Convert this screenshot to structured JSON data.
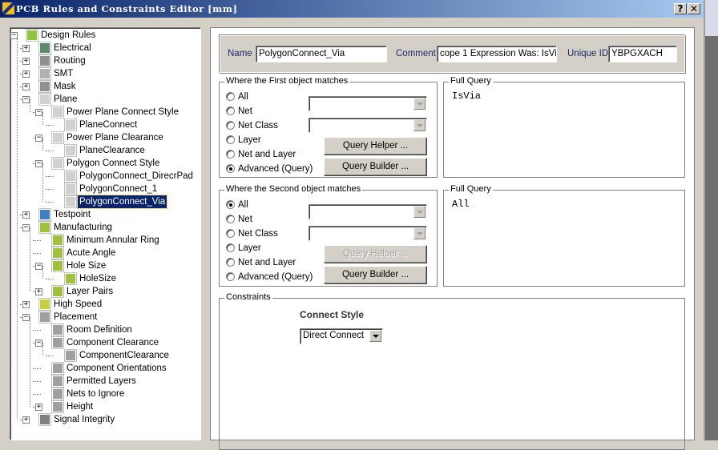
{
  "window": {
    "title": "PCB Rules and Constraints Editor [mm]",
    "help_label": "?",
    "close_label": "✕"
  },
  "colors": {
    "title_start": "#0a246a",
    "title_end": "#a6caf0",
    "selection": "#0a246a",
    "face": "#d4d0c8"
  },
  "tree": [
    {
      "label": "Design Rules",
      "level": 0,
      "exp": "-",
      "icon": "design-rules-folder-icon",
      "color": "#8fc43c"
    },
    {
      "label": "Electrical",
      "level": 1,
      "exp": "+",
      "icon": "electrical-icon",
      "color": "#5a8a6a"
    },
    {
      "label": "Routing",
      "level": 1,
      "exp": "+",
      "icon": "routing-icon",
      "color": "#909090"
    },
    {
      "label": "SMT",
      "level": 1,
      "exp": "+",
      "icon": "smt-icon",
      "color": "#b0b0b0"
    },
    {
      "label": "Mask",
      "level": 1,
      "exp": "+",
      "icon": "mask-icon",
      "color": "#909090"
    },
    {
      "label": "Plane",
      "level": 1,
      "exp": "-",
      "icon": "plane-icon",
      "color": "#d0d0d0"
    },
    {
      "label": "Power Plane Connect Style",
      "level": 2,
      "exp": "-",
      "icon": "plane-icon",
      "color": "#d0d0d0"
    },
    {
      "label": "PlaneConnect",
      "level": 3,
      "exp": "",
      "icon": "plane-icon",
      "color": "#d0d0d0"
    },
    {
      "label": "Power Plane Clearance",
      "level": 2,
      "exp": "-",
      "icon": "plane-icon",
      "color": "#d0d0d0"
    },
    {
      "label": "PlaneClearance",
      "level": 3,
      "exp": "",
      "icon": "plane-icon",
      "color": "#d0d0d0"
    },
    {
      "label": "Polygon Connect Style",
      "level": 2,
      "exp": "-",
      "icon": "plane-icon",
      "color": "#d0d0d0"
    },
    {
      "label": "PolygonConnect_DirecrPad",
      "level": 3,
      "exp": "",
      "icon": "plane-icon",
      "color": "#d0d0d0"
    },
    {
      "label": "PolygonConnect_1",
      "level": 3,
      "exp": "",
      "icon": "plane-icon",
      "color": "#d0d0d0"
    },
    {
      "label": "PolygonConnect_Via",
      "level": 3,
      "exp": "",
      "icon": "plane-icon",
      "color": "#d0d0d0",
      "selected": true
    },
    {
      "label": "Testpoint",
      "level": 1,
      "exp": "+",
      "icon": "testpoint-icon",
      "color": "#4080c0"
    },
    {
      "label": "Manufacturing",
      "level": 1,
      "exp": "-",
      "icon": "manufacturing-icon",
      "color": "#a0c040"
    },
    {
      "label": "Minimum Annular Ring",
      "level": 2,
      "exp": "",
      "icon": "manufacturing-icon",
      "color": "#a0c040"
    },
    {
      "label": "Acute Angle",
      "level": 2,
      "exp": "",
      "icon": "manufacturing-icon",
      "color": "#a0c040"
    },
    {
      "label": "Hole Size",
      "level": 2,
      "exp": "-",
      "icon": "manufacturing-icon",
      "color": "#a0c040"
    },
    {
      "label": "HoleSize",
      "level": 3,
      "exp": "",
      "icon": "manufacturing-icon",
      "color": "#a0c040"
    },
    {
      "label": "Layer Pairs",
      "level": 2,
      "exp": "+",
      "icon": "manufacturing-icon",
      "color": "#a0c040"
    },
    {
      "label": "High Speed",
      "level": 1,
      "exp": "+",
      "icon": "high-speed-icon",
      "color": "#c8d040"
    },
    {
      "label": "Placement",
      "level": 1,
      "exp": "-",
      "icon": "placement-icon",
      "color": "#a0a0a0"
    },
    {
      "label": "Room Definition",
      "level": 2,
      "exp": "",
      "icon": "placement-icon",
      "color": "#a0a0a0"
    },
    {
      "label": "Component Clearance",
      "level": 2,
      "exp": "-",
      "icon": "placement-icon",
      "color": "#a0a0a0"
    },
    {
      "label": "ComponentClearance",
      "level": 3,
      "exp": "",
      "icon": "placement-icon",
      "color": "#a0a0a0"
    },
    {
      "label": "Component Orientations",
      "level": 2,
      "exp": "",
      "icon": "placement-icon",
      "color": "#a0a0a0"
    },
    {
      "label": "Permitted Layers",
      "level": 2,
      "exp": "",
      "icon": "placement-icon",
      "color": "#a0a0a0"
    },
    {
      "label": "Nets to Ignore",
      "level": 2,
      "exp": "",
      "icon": "placement-icon",
      "color": "#a0a0a0"
    },
    {
      "label": "Height",
      "level": 2,
      "exp": "+",
      "icon": "placement-icon",
      "color": "#a0a0a0"
    },
    {
      "label": "Signal Integrity",
      "level": 1,
      "exp": "+",
      "icon": "signal-integrity-icon",
      "color": "#808080"
    }
  ],
  "header": {
    "name_label": "Name",
    "name_value": "PolygonConnect_Via",
    "comment_label": "Comment",
    "comment_value": "cope 1 Expression Was: IsVia",
    "uid_label": "Unique ID",
    "uid_value": "YBPGXACH"
  },
  "first": {
    "title": "Where the First object matches",
    "options": [
      "All",
      "Net",
      "Net Class",
      "Layer",
      "Net and Layer",
      "Advanced (Query)"
    ],
    "selected": "Advanced (Query)",
    "helper": "Query Helper ...",
    "builder": "Query Builder ...",
    "helper_enabled": true,
    "query_title": "Full Query",
    "query": "IsVia"
  },
  "second": {
    "title": "Where the Second object matches",
    "options": [
      "All",
      "Net",
      "Net Class",
      "Layer",
      "Net and Layer",
      "Advanced (Query)"
    ],
    "selected": "All",
    "helper": "Query Helper ...",
    "builder": "Query Builder ...",
    "helper_enabled": false,
    "query_title": "Full Query",
    "query": "All"
  },
  "constraints": {
    "title": "Constraints",
    "connect_style_label": "Connect Style",
    "connect_style_value": "Direct Connect"
  }
}
